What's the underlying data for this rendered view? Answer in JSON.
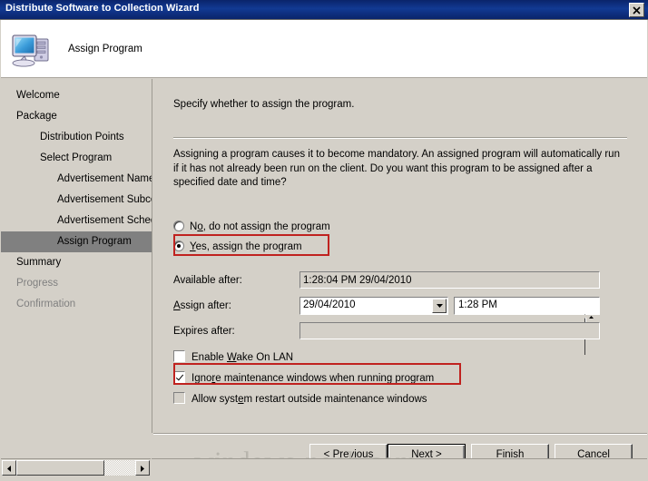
{
  "window": {
    "title": "Distribute Software to Collection Wizard",
    "close_label": "×"
  },
  "header": {
    "title": "Assign Program",
    "icon": "computer-icon"
  },
  "sidebar": {
    "items": [
      {
        "label": "Welcome",
        "level": 0,
        "state": "normal"
      },
      {
        "label": "Package",
        "level": 0,
        "state": "normal"
      },
      {
        "label": "Distribution Points",
        "level": 1,
        "state": "normal"
      },
      {
        "label": "Select Program",
        "level": 1,
        "state": "normal"
      },
      {
        "label": "Advertisement Name",
        "level": 2,
        "state": "normal"
      },
      {
        "label": "Advertisement Subcollec",
        "level": 2,
        "state": "normal"
      },
      {
        "label": "Advertisement Schedule",
        "level": 2,
        "state": "normal"
      },
      {
        "label": "Assign Program",
        "level": 2,
        "state": "current"
      },
      {
        "label": "Summary",
        "level": 0,
        "state": "normal"
      },
      {
        "label": "Progress",
        "level": 0,
        "state": "disabled"
      },
      {
        "label": "Confirmation",
        "level": 0,
        "state": "disabled"
      }
    ]
  },
  "main": {
    "intro": "Specify whether to assign the program.",
    "description": "Assigning a program causes it to become mandatory. An assigned program will automatically run if it has not already been run on the client. Do you want this program to be assigned after a specified date and time?",
    "radios": [
      {
        "label_pre": "N",
        "label_accel": "o",
        "label_post": ", do not assign the program",
        "checked": false
      },
      {
        "label_pre": "",
        "label_accel": "Y",
        "label_post": "es, assign the program",
        "checked": true
      }
    ],
    "fields": {
      "available_after_label": "Available after:",
      "available_after_value": "1:28:04 PM 29/04/2010",
      "assign_after_label_pre": "",
      "assign_after_label_accel": "A",
      "assign_after_label_post": "ssign after:",
      "assign_after_date": "29/04/2010",
      "assign_after_time": "1:28 PM",
      "expires_after_label": "Expires after:",
      "expires_after_value": ""
    },
    "checkboxes": [
      {
        "pre": "Enable ",
        "accel": "W",
        "post": "ake On LAN",
        "checked": false,
        "enabled": true
      },
      {
        "pre": "Igno",
        "accel": "r",
        "post": "e maintenance windows when running program",
        "checked": true,
        "enabled": true
      },
      {
        "pre": "Allow syst",
        "accel": "e",
        "post": "m restart outside maintenance windows",
        "checked": false,
        "enabled": false
      }
    ]
  },
  "footer": {
    "previous_pre": "< ",
    "previous_accel": "P",
    "previous_post": "revious",
    "next_pre": "",
    "next_accel": "N",
    "next_post": "ext >",
    "finish_pre": "",
    "finish_accel": "F",
    "finish_post": "inish",
    "cancel_pre": "",
    "cancel_accel": "C",
    "cancel_post": "ancel"
  },
  "watermark": "windows-noob.com",
  "colors": {
    "titlebar": "#0a246a",
    "face": "#d4d0c8",
    "annotation": "#c0221f",
    "highlight": "#808080"
  }
}
